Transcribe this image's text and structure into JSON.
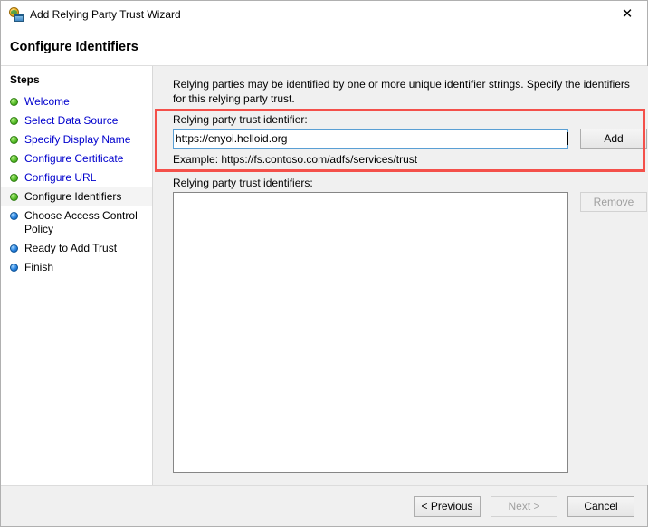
{
  "window": {
    "title": "Add Relying Party Trust Wizard",
    "icon": "relying-party-globe-icon",
    "close_label": "✕"
  },
  "header": {
    "title": "Configure Identifiers"
  },
  "sidebar": {
    "title": "Steps",
    "items": [
      {
        "label": "Welcome",
        "state": "done",
        "current": false
      },
      {
        "label": "Select Data Source",
        "state": "done",
        "current": false
      },
      {
        "label": "Specify Display Name",
        "state": "done",
        "current": false
      },
      {
        "label": "Configure Certificate",
        "state": "done",
        "current": false
      },
      {
        "label": "Configure URL",
        "state": "done",
        "current": false
      },
      {
        "label": "Configure Identifiers",
        "state": "done",
        "current": true
      },
      {
        "label": "Choose Access Control Policy",
        "state": "todo",
        "current": false
      },
      {
        "label": "Ready to Add Trust",
        "state": "todo",
        "current": false
      },
      {
        "label": "Finish",
        "state": "todo",
        "current": false
      }
    ]
  },
  "content": {
    "intro": "Relying parties may be identified by one or more unique identifier strings. Specify the identifiers for this relying party trust.",
    "identifier_label": "Relying party trust identifier:",
    "identifier_value": "https://enyoi.helloid.org",
    "identifier_placeholder": "",
    "add_label": "Add",
    "example_text": "Example: https://fs.contoso.com/adfs/services/trust",
    "list_label": "Relying party trust identifiers:",
    "list_items": [],
    "remove_label": "Remove"
  },
  "footer": {
    "previous_label": "< Previous",
    "next_label": "Next >",
    "cancel_label": "Cancel"
  },
  "colors": {
    "highlight": "#f4504a",
    "link": "#0000cd",
    "done_bullet": "#4eb41b",
    "todo_bullet": "#2a84e0",
    "content_bg": "#f0f0f0"
  }
}
